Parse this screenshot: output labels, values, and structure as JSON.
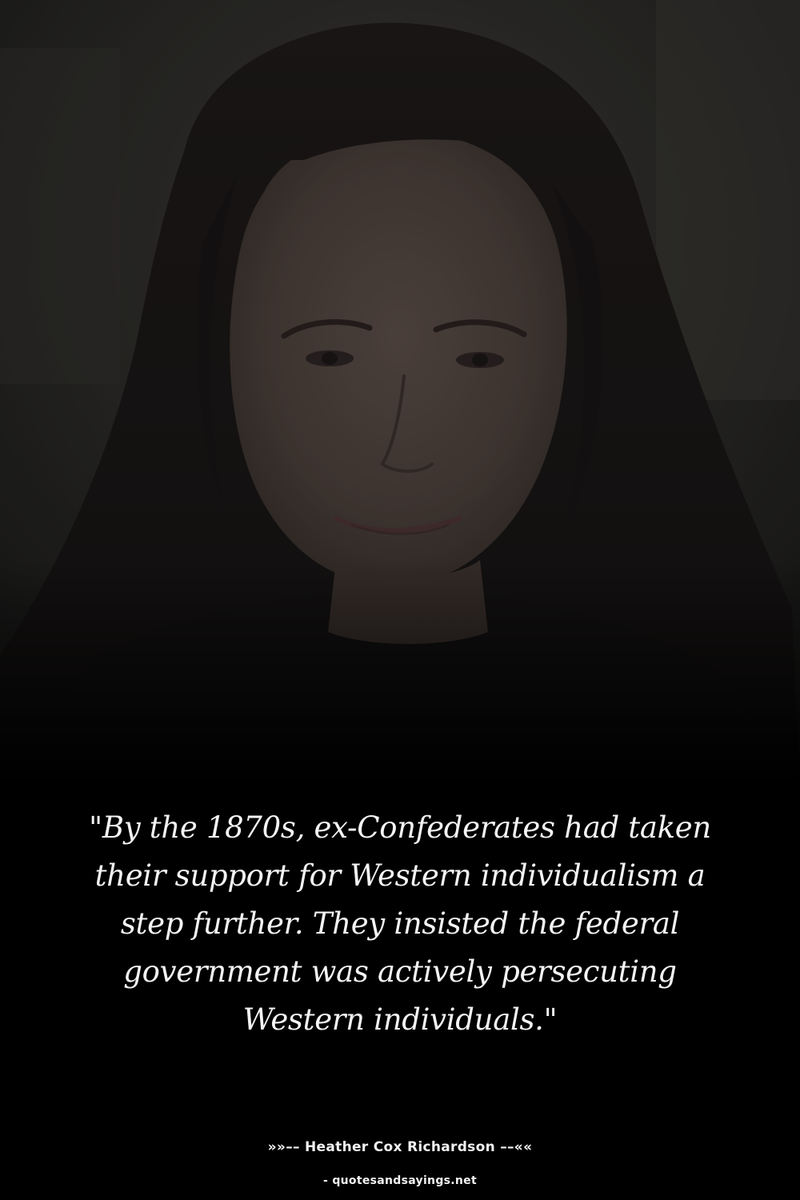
{
  "quote": {
    "text": "\"By the 1870s, ex-Confederates had taken their support for Western individualism a step further. They insisted the federal government was actively persecuting Western individuals.\""
  },
  "attribution": {
    "author_line": "»»–– Heather Cox Richardson ––««"
  },
  "footer": {
    "site": "- quotesandsayings.net"
  },
  "colors": {
    "background": "#000000",
    "text": "#f4f4f4"
  }
}
